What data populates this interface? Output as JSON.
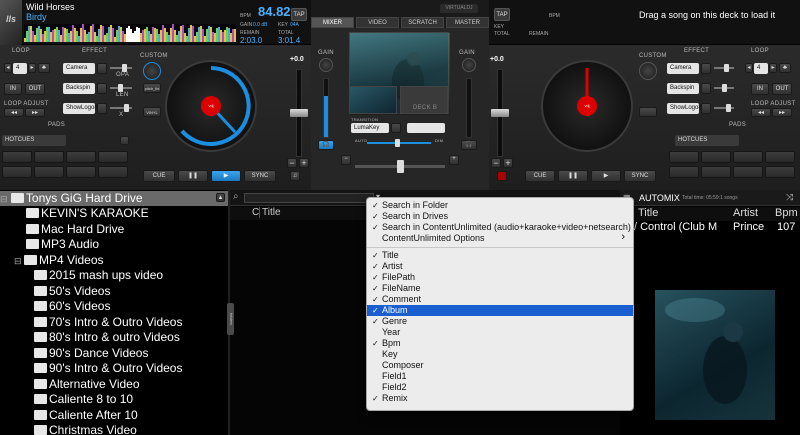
{
  "left_deck": {
    "cover_text": "lls",
    "title": "Wild Horses",
    "artist": "Birdy",
    "bpm_label": "BPM",
    "bpm": "84.82",
    "tap_label": "TAP",
    "gain_label": "GAIN",
    "gain_value": "0.0 dB",
    "key_label": "KEY",
    "key_value": "04A",
    "remain_label": "REMAIN",
    "remain": "2:03.0",
    "total_label": "TOTAL",
    "total": "3:01.4",
    "loop_label": "LOOP",
    "loop_value": "4",
    "in_label": "IN",
    "out_label": "OUT",
    "loop_adjust_label": "LOOP ADJUST",
    "effect_label": "EFFECT",
    "custom_label": "CUSTOM",
    "effects": [
      "Camera",
      "Backspin",
      "ShowLogo8"
    ],
    "opa_label": "OPA",
    "len_label": "LEN",
    "x_label": "X",
    "pads_label": "PADS",
    "hotcues_label": "HOTCUES",
    "pitch_value": "+0.0",
    "cue_label": "CUE",
    "sync_label": "SYNC",
    "pitch_lbl_small": "pitch_lbl",
    "vinyl_label": "VINYL",
    "platter_label": "vdj"
  },
  "right_deck": {
    "tap_label": "TAP",
    "bpm_label": "BPM",
    "key_label": "KEY",
    "total_label": "TOTAL",
    "remain_label": "REMAIN",
    "hint": "Drag a song on this deck to load it",
    "effect_label": "EFFECT",
    "loop_label": "LOOP",
    "loop_value": "4",
    "in_label": "IN",
    "out_label": "OUT",
    "loop_adjust_label": "LOOP ADJUST",
    "effects": [
      "Camera",
      "Backspin",
      "ShowLogo8"
    ],
    "custom_label": "CUSTOM",
    "pads_label": "PADS",
    "hotcues_label": "HOTCUES",
    "pitch_value": "+0.0",
    "cue_label": "CUE",
    "sync_label": "SYNC"
  },
  "mixer": {
    "tabs": [
      "MIXER",
      "VIDEO",
      "SCRATCH",
      "MASTER"
    ],
    "logo": "VIRTUALDJ",
    "gain_label": "GAIN",
    "transition_label": "TRANSITION",
    "transition_value": "LumaKey",
    "deck_b_label": "DECK B",
    "auto_label": "AUTO",
    "dim_label": "DIM"
  },
  "browser": {
    "root_folder": "Tonys GiG Hard Drive",
    "folders": [
      "KEVIN'S KARAOKE",
      "Mac Hard Drive",
      "MP3 Audio",
      "MP4 Videos",
      "2015 mash ups video",
      "50's Videos",
      "60's Videos",
      "70's Intro & Outro Videos",
      "80's Intro & outro Videos",
      "90's Dance Videos",
      "90's Intro & Outro Videos",
      "Alternative Video",
      "Caliente 8 to 10",
      "Caliente After 10",
      "Christmas Video"
    ],
    "col_title": "Title",
    "col_prefix": "C",
    "side_tab": "folders"
  },
  "automix": {
    "title": "AUTOMIX",
    "total_time": "Total time: 05:59:1 songs",
    "col_title": "Title",
    "col_artist": "Artist",
    "col_bpm": "Bpm",
    "row_title": "/ Control (Club M",
    "row_artist": "Prince",
    "row_bpm": "107"
  },
  "context_menu": {
    "group1": [
      {
        "label": "Search in Folder",
        "checked": true
      },
      {
        "label": "Search in Drives",
        "checked": true
      },
      {
        "label": "Search in ContentUnlimited (audio+karaoke+video+netsearch)",
        "checked": true
      },
      {
        "label": "ContentUnlimited Options",
        "checked": false,
        "submenu": true
      }
    ],
    "group2": [
      {
        "label": "Title",
        "checked": true
      },
      {
        "label": "Artist",
        "checked": true
      },
      {
        "label": "FilePath",
        "checked": true
      },
      {
        "label": "FileName",
        "checked": true
      },
      {
        "label": "Comment",
        "checked": true
      },
      {
        "label": "Album",
        "checked": true,
        "highlighted": true
      },
      {
        "label": "Genre",
        "checked": true
      },
      {
        "label": "Year",
        "checked": false
      },
      {
        "label": "Bpm",
        "checked": true
      },
      {
        "label": "Key",
        "checked": false
      },
      {
        "label": "Composer",
        "checked": false
      },
      {
        "label": "Field1",
        "checked": false
      },
      {
        "label": "Field2",
        "checked": false
      },
      {
        "label": "Remix",
        "checked": true
      }
    ],
    "check_glyph": "✓"
  },
  "colors": {
    "accent_blue": "#1a8ee0",
    "bpm_blue": "#4db1ff",
    "platter_center": "#dd0000",
    "menu_highlight": "#1a5fd0"
  }
}
